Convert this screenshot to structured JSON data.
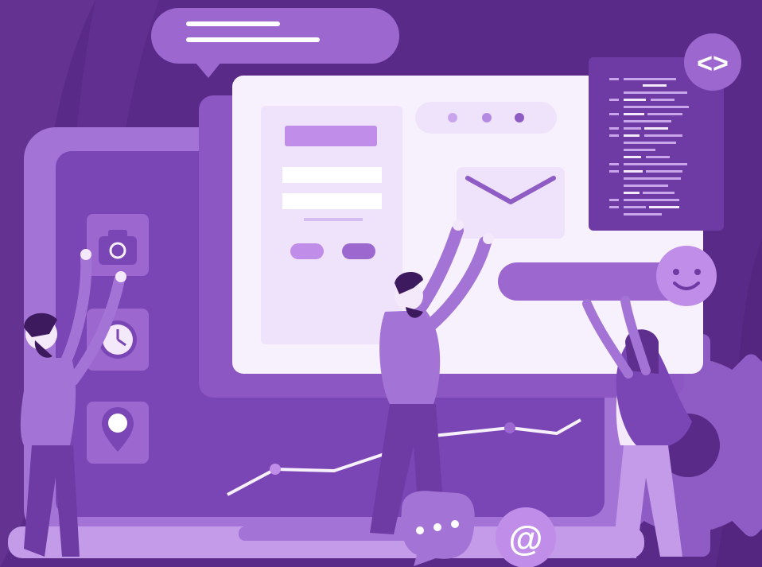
{
  "illustration": {
    "theme": "web-development-team",
    "code_badge_label": "<>",
    "mention_label": "@",
    "colors": {
      "background": "#5a2a88",
      "background_swirl": "#6a3a98",
      "laptop_body": "#8e5cc4",
      "laptop_screen": "#7a45b4",
      "window_white": "#f7f1fd",
      "panel_light": "#efe3fb",
      "accent": "#c08ee8",
      "accent_dark": "#9c68d0",
      "code_panel": "#6e3aa4",
      "skin": "#f4e8fb"
    },
    "icons": [
      "camera-icon",
      "clock-icon",
      "location-pin-icon",
      "envelope-icon",
      "smiley-icon",
      "chat-bubble-icon",
      "at-sign-icon",
      "code-brackets-icon",
      "gear-icon"
    ],
    "people_count": 3
  }
}
